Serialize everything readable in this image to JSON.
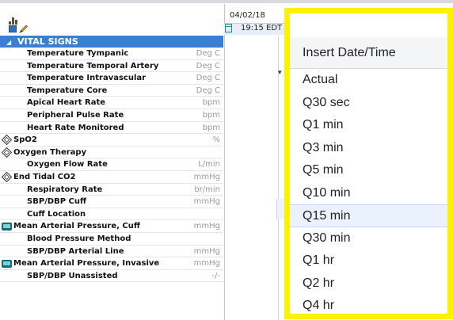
{
  "header": {
    "date": "04/02/18",
    "time": "19:15 EDT"
  },
  "section": {
    "title": "VITAL SIGNS",
    "toggle": "◢"
  },
  "rows": [
    {
      "label": "Temperature Tympanic",
      "unit": "Deg C",
      "icon": ""
    },
    {
      "label": "Temperature Temporal Artery",
      "unit": "Deg C",
      "icon": ""
    },
    {
      "label": "Temperature Intravascular",
      "unit": "Deg C",
      "icon": ""
    },
    {
      "label": "Temperature Core",
      "unit": "Deg C",
      "icon": ""
    },
    {
      "label": "Apical Heart Rate",
      "unit": "bpm",
      "icon": ""
    },
    {
      "label": "Peripheral Pulse Rate",
      "unit": "bpm",
      "icon": ""
    },
    {
      "label": "Heart Rate Monitored",
      "unit": "bpm",
      "icon": ""
    },
    {
      "label": "SpO2",
      "unit": "%",
      "icon": "diamond-icon"
    },
    {
      "label": "Oxygen Therapy",
      "unit": "",
      "icon": "diamond-icon"
    },
    {
      "label": "Oxygen Flow Rate",
      "unit": "L/min",
      "icon": ""
    },
    {
      "label": "End Tidal CO2",
      "unit": "mmHg",
      "icon": "diamond-icon"
    },
    {
      "label": "Respiratory Rate",
      "unit": "br/min",
      "icon": ""
    },
    {
      "label": "SBP/DBP Cuff",
      "unit": "mmHg",
      "icon": ""
    },
    {
      "label": "Cuff Location",
      "unit": "",
      "icon": ""
    },
    {
      "label": "Mean Arterial Pressure, Cuff",
      "unit": "mmHg",
      "icon": "monitor-icon"
    },
    {
      "label": "Blood Pressure Method",
      "unit": "",
      "icon": ""
    },
    {
      "label": "SBP/DBP Arterial Line",
      "unit": "mmHg",
      "icon": ""
    },
    {
      "label": "Mean Arterial Pressure, Invasive",
      "unit": "mmHg",
      "icon": "monitor-icon"
    },
    {
      "label": "SBP/DBP Unassisted",
      "unit": "-/-",
      "icon": ""
    }
  ],
  "popup": {
    "title": "Insert Date/Time",
    "items": [
      "Actual",
      "Q30 sec",
      "Q1 min",
      "Q3 min",
      "Q5 min",
      "Q10 min",
      "Q15 min",
      "Q30 min",
      "Q1 hr",
      "Q2 hr",
      "Q4 hr"
    ],
    "selected": "Q15 min",
    "highlight_color": "#fff200"
  },
  "colors": {
    "section_bg": "#3a7fd1",
    "unit_text": "#9a9a9a"
  }
}
